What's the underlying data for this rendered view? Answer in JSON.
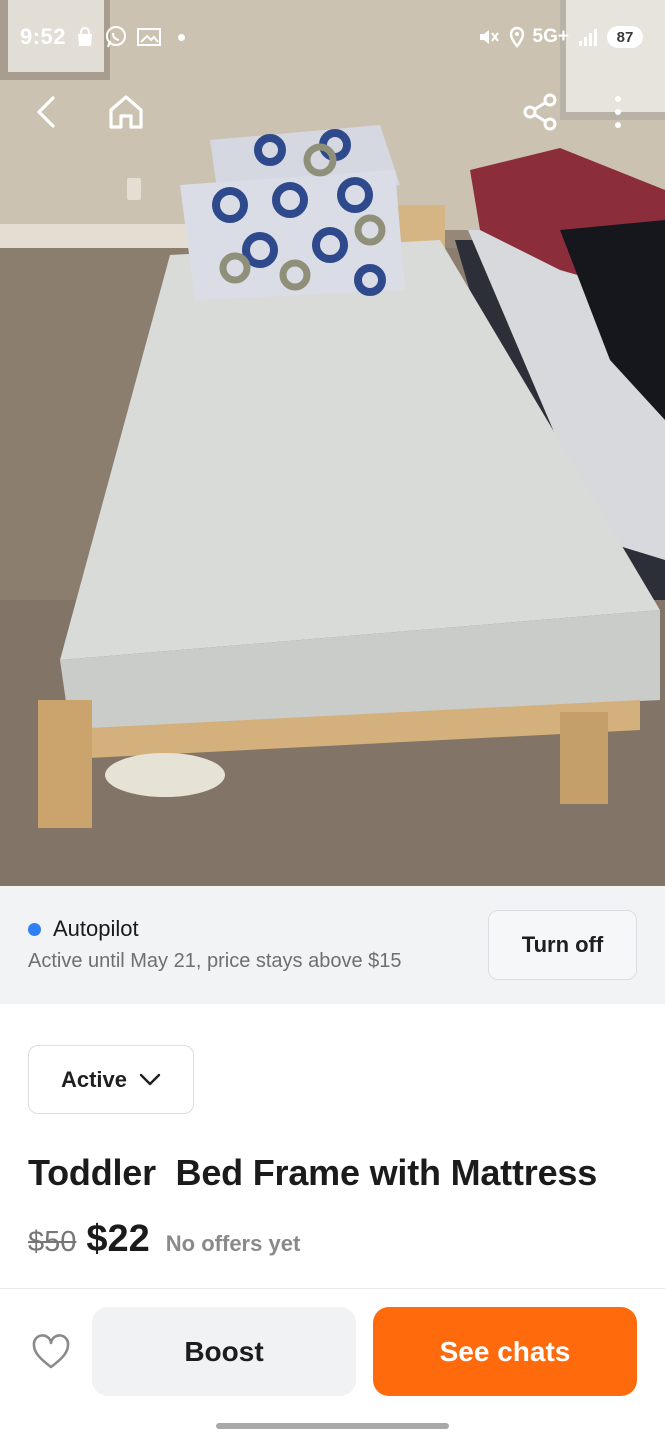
{
  "status_bar": {
    "time": "9:52",
    "network": "5G+",
    "battery": "87",
    "icons": [
      "shopping-bag-icon",
      "whatsapp-icon",
      "gallery-icon",
      "mute-icon",
      "location-icon",
      "signal-icon"
    ]
  },
  "toolbar": {
    "icons": [
      "back-icon",
      "home-icon",
      "share-icon",
      "more-vertical-icon"
    ]
  },
  "photo": {
    "subject": "wooden bed frame with mattress",
    "colors": {
      "wall": "#cfc6b6",
      "carpet": "#8f8171",
      "sheet": "#dcdedb",
      "wood": "#d9b98a"
    }
  },
  "autopilot": {
    "title": "Autopilot",
    "subtitle": "Active until May 21, price stays above $15",
    "turn_off_label": "Turn off",
    "dot_color": "#2f7ff5"
  },
  "listing": {
    "status": "Active",
    "title": "Toddler  Bed Frame with Mattress",
    "original_price": "$50",
    "price": "$22",
    "offers_text": "No offers yet"
  },
  "actions": {
    "boost_label": "Boost",
    "see_chats_label": "See chats",
    "accent_color": "#ff6a0d"
  }
}
